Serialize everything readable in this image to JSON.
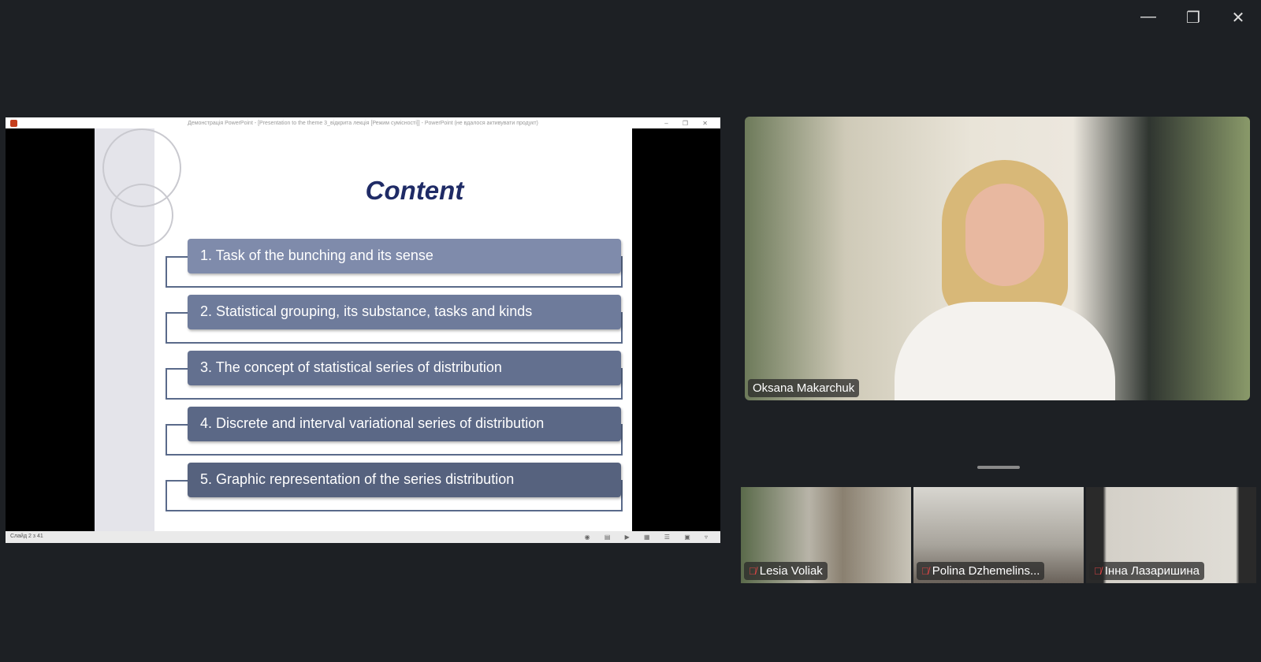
{
  "window": {
    "minimize_icon": "minimize-icon",
    "restore_icon": "restore-icon",
    "close_icon": "close-icon"
  },
  "ppt": {
    "window_title": "Демонстрація PowerPoint - [Presentation to the theme 3_відкрита лекція [Режим сумісності]] - PowerPoint (не вдалося активувати продукт)",
    "status": "Слайд 2 з 41",
    "slide": {
      "title": "Content",
      "items": [
        {
          "label": "1. Task of the bunching and its sense",
          "color": "#7f8bab"
        },
        {
          "label": "2. Statistical grouping, its substance, tasks and kinds",
          "color": "#6e7b9b"
        },
        {
          "label": "3. The concept of statistical series of distribution",
          "color": "#63708f"
        },
        {
          "label": "4. Discrete and interval variational series of distribution",
          "color": "#5b6886"
        },
        {
          "label": "5. Graphic representation of the series distribution",
          "color": "#56627e"
        }
      ]
    }
  },
  "speaker": {
    "name": "Oksana Makarchuk"
  },
  "participants": [
    {
      "name": "Lesia Voliak",
      "muted": true
    },
    {
      "name": "Polina Dzhemelins...",
      "muted": true
    },
    {
      "name": "Інна Лазаришина",
      "muted": true
    }
  ]
}
